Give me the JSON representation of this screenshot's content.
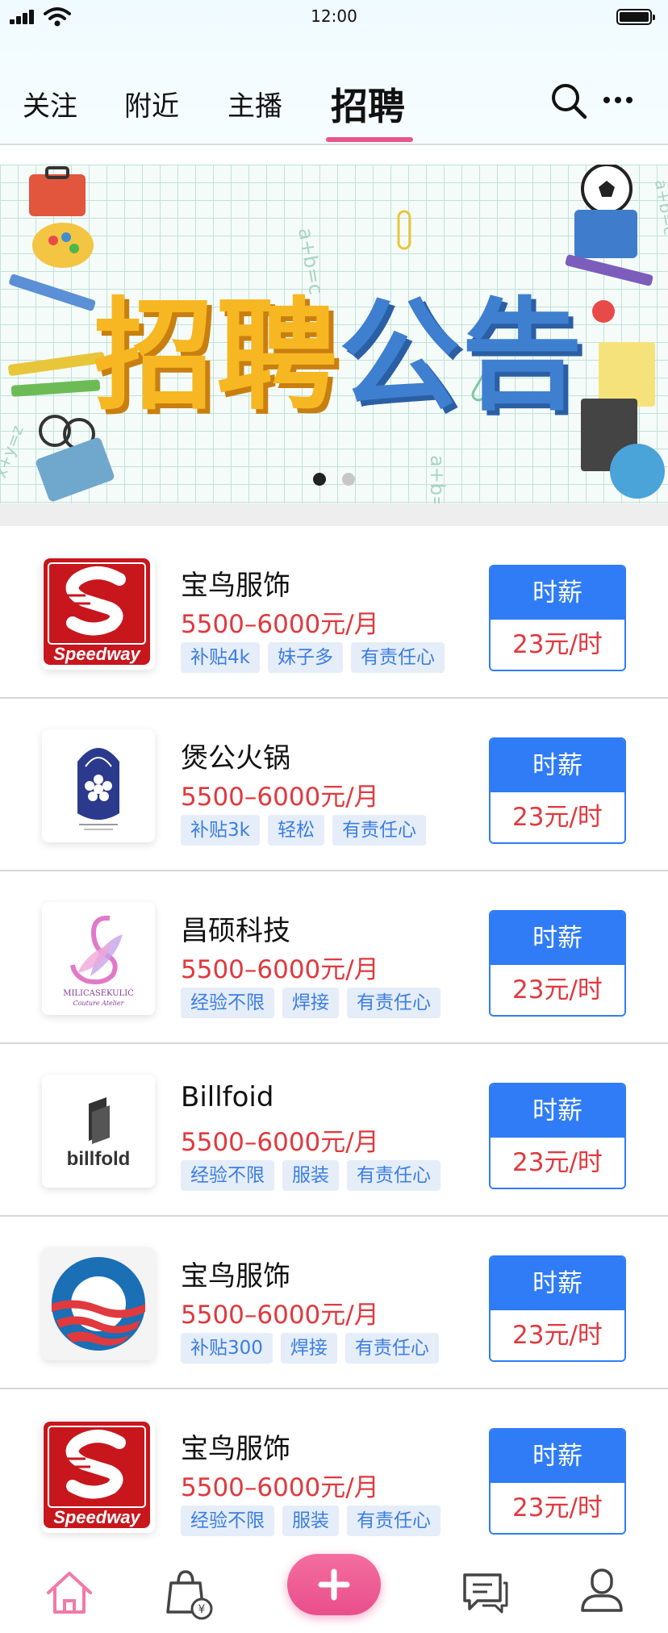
{
  "status_bar": {
    "time": "12:00"
  },
  "header": {
    "tabs": [
      {
        "label": "关注"
      },
      {
        "label": "附近"
      },
      {
        "label": "主播"
      },
      {
        "label": "招聘"
      }
    ],
    "active_tab": "招聘",
    "accent_color": "#e9568a"
  },
  "banner": {
    "title_part1": "招聘",
    "title_part2": "公告",
    "slide_count": 2,
    "active_slide": 1
  },
  "jobs": [
    {
      "company": "宝鸟服饰",
      "salary": "5500–6000元/月",
      "tags": [
        "补贴4k",
        "妹子多",
        "有责任心"
      ],
      "wage_label": "时薪",
      "wage_value": "23元/时",
      "logo": "speedway",
      "logo_text": "Speedway"
    },
    {
      "company": "煲公火锅",
      "salary": "5500–6000元/月",
      "tags": [
        "补贴3k",
        "轻松",
        "有责任心"
      ],
      "wage_label": "时薪",
      "wage_value": "23元/时",
      "logo": "orchid-crest"
    },
    {
      "company": "昌硕科技",
      "salary": "5500–6000元/月",
      "tags": [
        "经验不限",
        "焊接",
        "有责任心"
      ],
      "wage_label": "时薪",
      "wage_value": "23元/时",
      "logo": "swan",
      "logo_text": "MILICASEKULIĆ",
      "logo_subtext": "Couture Atelier"
    },
    {
      "company": "Billfoid",
      "salary": "5500–6000元/月",
      "tags": [
        "经验不限",
        "服装",
        "有责任心"
      ],
      "wage_label": "时薪",
      "wage_value": "23元/时",
      "logo": "billfold",
      "logo_text": "billfold"
    },
    {
      "company": "宝鸟服饰",
      "salary": "5500–6000元/月",
      "tags": [
        "补贴300",
        "焊接",
        "有责任心"
      ],
      "wage_label": "时薪",
      "wage_value": "23元/时",
      "logo": "obama-o"
    },
    {
      "company": "宝鸟服饰",
      "salary": "5500–6000元/月",
      "tags": [
        "经验不限",
        "服装",
        "有责任心"
      ],
      "wage_label": "时薪",
      "wage_value": "23元/时",
      "logo": "speedway",
      "logo_text": "Speedway"
    }
  ],
  "bottom_nav": {
    "items": [
      {
        "icon": "home-icon",
        "active": true
      },
      {
        "icon": "shopping-bag-icon",
        "active": false
      },
      {
        "icon": "plus-icon",
        "active": false
      },
      {
        "icon": "chat-icon",
        "active": false
      },
      {
        "icon": "user-icon",
        "active": false
      }
    ],
    "active_color": "#f07aa8"
  },
  "colors": {
    "primary_blue": "#2f7cf6",
    "salary_red": "#e0393e",
    "tag_bg": "#e5edf9",
    "tag_text": "#3c7ee2"
  }
}
